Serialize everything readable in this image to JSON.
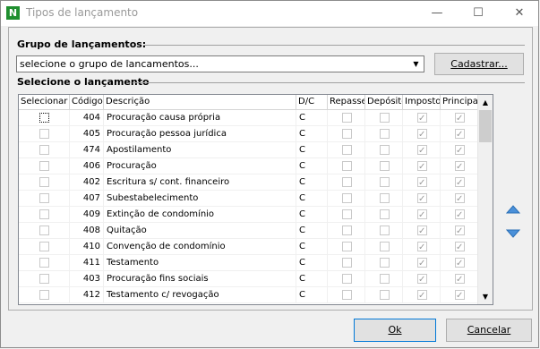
{
  "window": {
    "title": "Tipos de lançamento",
    "app_icon_letter": "N"
  },
  "group": {
    "label": "Grupo de lançamentos:",
    "select_value": "selecione o grupo de lancamentos...",
    "register_button": "Cadastrar..."
  },
  "select_label": "Selecione o lançamento",
  "table": {
    "columns": [
      "Selecionar",
      "Código",
      "Descrição",
      "D/C",
      "Repasse",
      "Depósito",
      "Imposto",
      "Principal"
    ],
    "rows": [
      {
        "codigo": "404",
        "descricao": "Procuração causa própria",
        "dc": "C",
        "selecionar": false,
        "repasse": false,
        "deposito": false,
        "imposto": true,
        "principal": true
      },
      {
        "codigo": "405",
        "descricao": "Procuração pessoa jurídica",
        "dc": "C",
        "selecionar": false,
        "repasse": false,
        "deposito": false,
        "imposto": true,
        "principal": true
      },
      {
        "codigo": "474",
        "descricao": "Apostilamento",
        "dc": "C",
        "selecionar": false,
        "repasse": false,
        "deposito": false,
        "imposto": true,
        "principal": true
      },
      {
        "codigo": "406",
        "descricao": "Procuração",
        "dc": "C",
        "selecionar": false,
        "repasse": false,
        "deposito": false,
        "imposto": true,
        "principal": true
      },
      {
        "codigo": "402",
        "descricao": "Escritura s/ cont. financeiro",
        "dc": "C",
        "selecionar": false,
        "repasse": false,
        "deposito": false,
        "imposto": true,
        "principal": true
      },
      {
        "codigo": "407",
        "descricao": "Subestabelecimento",
        "dc": "C",
        "selecionar": false,
        "repasse": false,
        "deposito": false,
        "imposto": true,
        "principal": true
      },
      {
        "codigo": "409",
        "descricao": "Extinção de condomínio",
        "dc": "C",
        "selecionar": false,
        "repasse": false,
        "deposito": false,
        "imposto": true,
        "principal": true
      },
      {
        "codigo": "408",
        "descricao": "Quitação",
        "dc": "C",
        "selecionar": false,
        "repasse": false,
        "deposito": false,
        "imposto": true,
        "principal": true
      },
      {
        "codigo": "410",
        "descricao": "Convenção de condomínio",
        "dc": "C",
        "selecionar": false,
        "repasse": false,
        "deposito": false,
        "imposto": true,
        "principal": true
      },
      {
        "codigo": "411",
        "descricao": "Testamento",
        "dc": "C",
        "selecionar": false,
        "repasse": false,
        "deposito": false,
        "imposto": true,
        "principal": true
      },
      {
        "codigo": "403",
        "descricao": "Procuração fins sociais",
        "dc": "C",
        "selecionar": false,
        "repasse": false,
        "deposito": false,
        "imposto": true,
        "principal": true
      },
      {
        "codigo": "412",
        "descricao": "Testamento c/ revogação",
        "dc": "C",
        "selecionar": false,
        "repasse": false,
        "deposito": false,
        "imposto": true,
        "principal": true
      }
    ]
  },
  "buttons": {
    "ok": "Ok",
    "cancel": "Cancelar"
  },
  "colors": {
    "accent": "#0078d7",
    "app_icon": "#1f8f2f",
    "arrow_blue": "#4a90d9"
  },
  "icons": {
    "app": "app-logo-icon",
    "minimize": "minimize-icon",
    "maximize": "maximize-icon",
    "close": "close-icon"
  }
}
